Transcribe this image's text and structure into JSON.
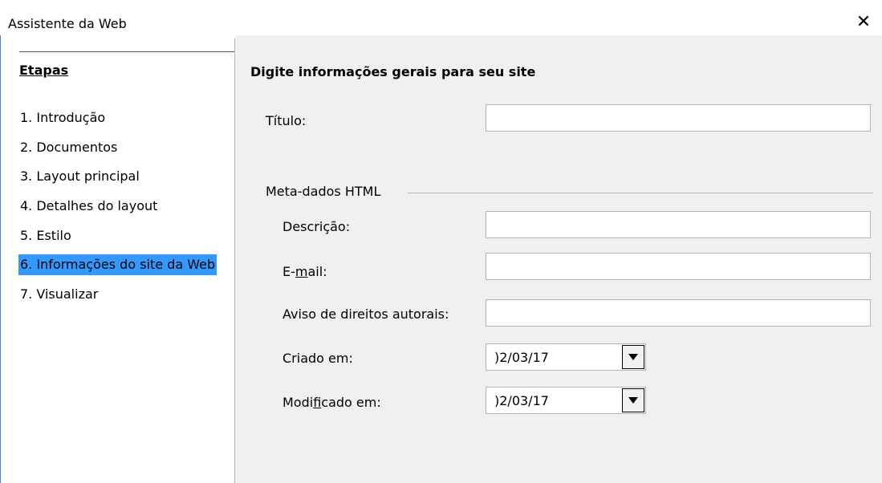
{
  "window": {
    "title": "Assistente da Web",
    "close_glyph": "✕"
  },
  "sidebar": {
    "heading": "Etapas",
    "steps": [
      {
        "label": "1. Introdução"
      },
      {
        "label": "2. Documentos"
      },
      {
        "label": "3. Layout principal"
      },
      {
        "label": "4. Detalhes do layout"
      },
      {
        "label": "5. Estilo"
      },
      {
        "label": "6. Informações do site da Web",
        "selected": true
      },
      {
        "label": "7. Visualizar"
      }
    ]
  },
  "main": {
    "heading": "Digite informações gerais para seu site",
    "title_label": "Título:",
    "title_value": "",
    "meta_group_label": "Meta-dados HTML",
    "description_label": "Descrição:",
    "description_value": "",
    "email_label_pre": "E-",
    "email_label_mnemonic": "m",
    "email_label_post": "ail:",
    "email_value": "",
    "copyright_label": "Aviso de direitos autorais:",
    "copyright_value": "",
    "created_label": "Criado em:",
    "created_value": ")2/03/17",
    "modified_label_pre": "Modi",
    "modified_label_mnemonic": "f",
    "modified_label_post": "icado em:",
    "modified_value": ")2/03/17"
  },
  "colors": {
    "selection": "#3399ff",
    "panel_bg": "#f0f0f0",
    "window_edge": "#3b8ad8"
  },
  "icons": {
    "close": "close-icon",
    "dropdown": "triangle-down-icon"
  }
}
